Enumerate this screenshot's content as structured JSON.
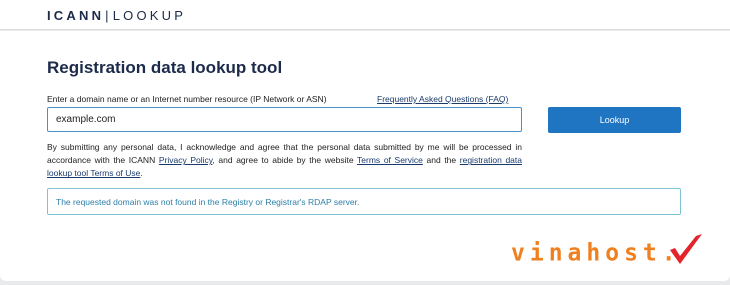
{
  "header": {
    "brand": "ICANN",
    "separator": "|",
    "product": "LOOKUP"
  },
  "main": {
    "title": "Registration data lookup tool",
    "prompt": "Enter a domain name or an Internet number resource (IP Network or ASN)",
    "faq_link": "Frequently Asked Questions (FAQ)",
    "search": {
      "value": "example.com",
      "placeholder": ""
    },
    "lookup_label": "Lookup",
    "disclaimer": {
      "part1": "By submitting any personal data, I acknowledge and agree that the personal data submitted by me will be processed in accordance with the ICANN ",
      "privacy_link": "Privacy Policy",
      "part2": ", and agree to abide by the website ",
      "terms_link": "Terms of Service",
      "part3": " and the ",
      "tool_terms_link": "registration data lookup tool Terms of Use",
      "part4": "."
    },
    "alert": "The requested domain was not found in the Registry or Registrar's RDAP server."
  },
  "watermark": {
    "text": "vinahost.",
    "check_icon": "checkmark-icon"
  },
  "colors": {
    "brand_navy": "#1c2b4a",
    "button_blue": "#1f75c2",
    "link_blue": "#1a3a6c",
    "alert_border": "#7cc3d4",
    "alert_text": "#2c7fa8",
    "watermark_orange": "#f0801f",
    "watermark_red": "#e4232a"
  }
}
